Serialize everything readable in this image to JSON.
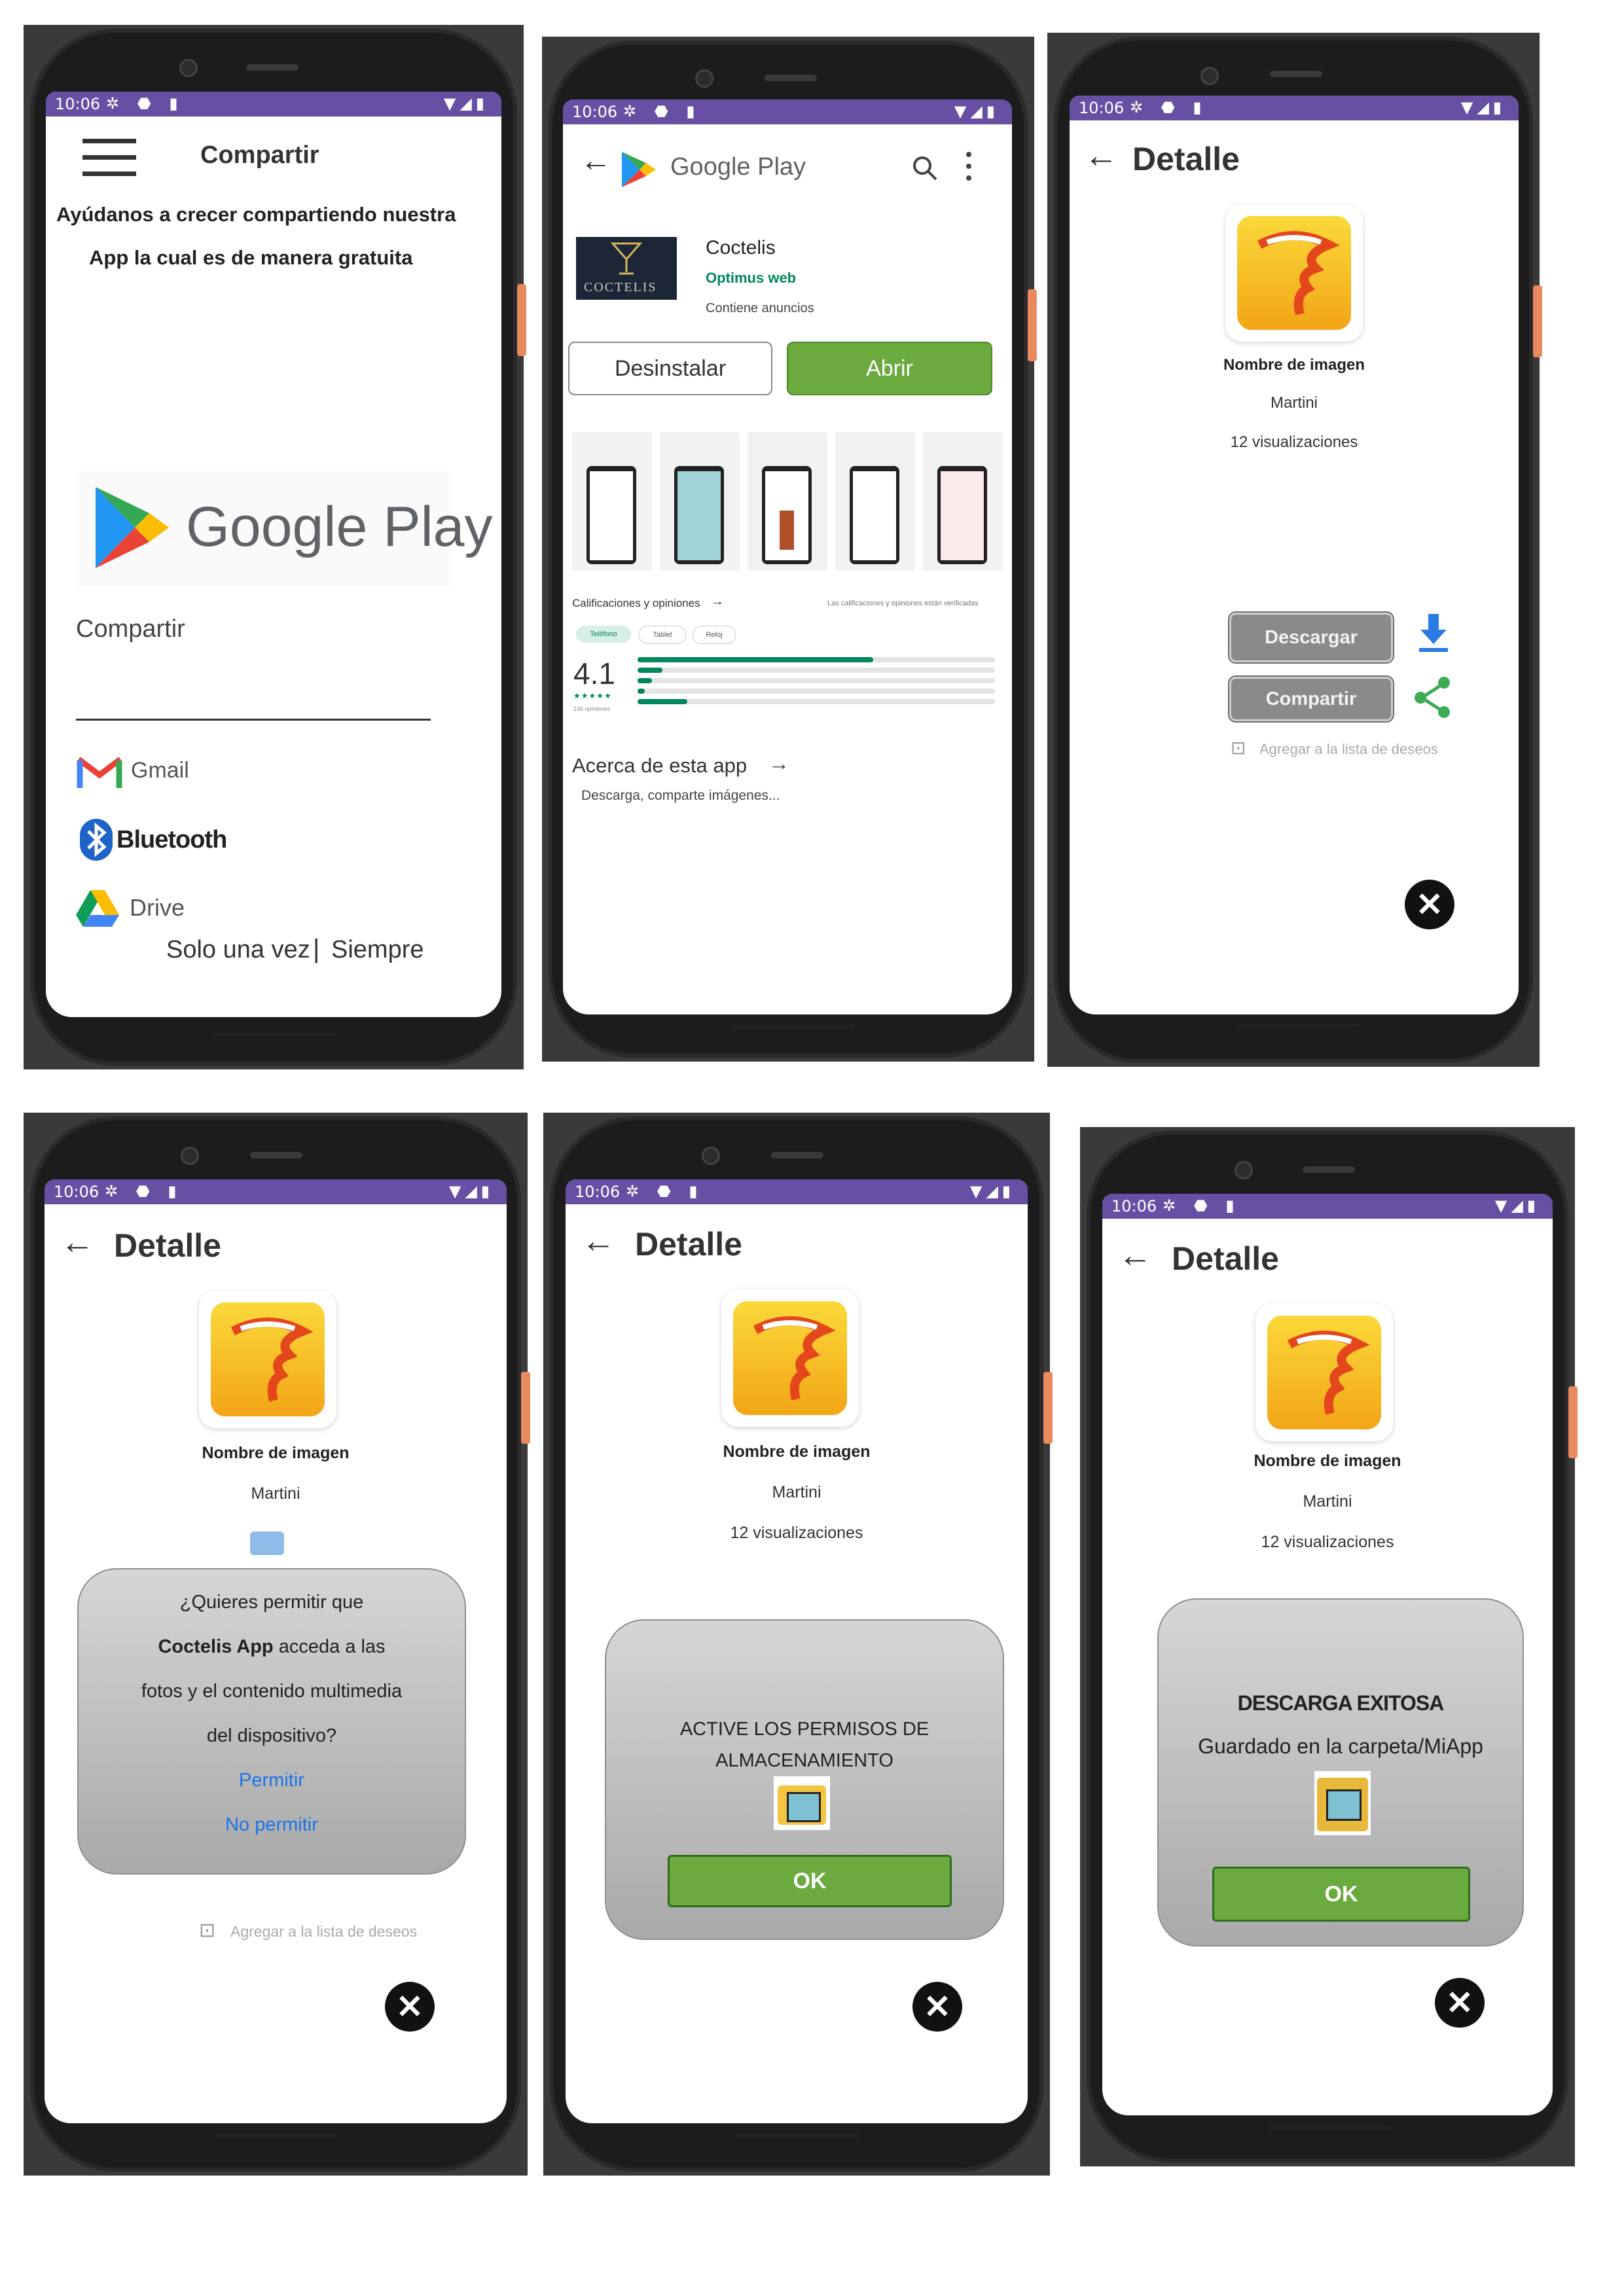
{
  "status": {
    "time": "10:06",
    "left_icons": "✲ ⬣ ▮",
    "right_icons": "▼◢▮"
  },
  "screen1": {
    "title": "Compartir",
    "message_line1": "Ayúdanos a crecer compartiendo nuestra",
    "message_line2": "App la cual es de manera gratuita",
    "gp_logo_text": "Google Play",
    "share_label": "Compartir",
    "options": [
      {
        "label": "Gmail",
        "icon": "gmail-icon"
      },
      {
        "label": "Bluetooth",
        "icon": "bluetooth-icon"
      },
      {
        "label": "Drive",
        "icon": "drive-icon"
      }
    ],
    "once": "Solo una vez",
    "separator": "|",
    "always": "Siempre"
  },
  "screen2": {
    "store_name": "Google Play",
    "app_name": "Coctelis",
    "developer": "Optimus web",
    "ads": "Contiene anuncios",
    "logo_text": "COCTELIS",
    "uninstall": "Desinstalar",
    "open": "Abrir",
    "ratings_title": "Calificaciones y opiniones",
    "ratings_note": "Las calificaciones y opiniones están verificadas",
    "chips": [
      "Teléfono",
      "Tablet",
      "Reloj"
    ],
    "rating": "4.1",
    "stars": "★★★★★",
    "reviews_count": "136 opiniones",
    "rating_bars": [
      0.66,
      0.07,
      0.04,
      0.02,
      0.14
    ],
    "about_title": "Acerca de esta app",
    "about_text": "Descarga, comparte imágenes..."
  },
  "detail": {
    "title": "Detalle",
    "image_name_label": "Nombre de imagen",
    "image_name": "Martini",
    "views": "12 visualizaciones",
    "download": "Descargar",
    "share": "Compartir",
    "wishlist": "Agregar a la lista de deseos",
    "close": "✕"
  },
  "permission_dialog": {
    "line1": "¿Quieres permitir que",
    "app": "Coctelis App",
    "line2_rest": "acceda a las",
    "line3": "fotos y el contenido multimedia",
    "line4": "del dispositivo?",
    "allow": "Permitir",
    "deny": "No permitir"
  },
  "storage_dialog": {
    "line1": "ACTIVE LOS PERMISOS DE",
    "line2": "ALMACENAMIENTO",
    "ok": "OK"
  },
  "success_dialog": {
    "title": "DESCARGA EXITOSA",
    "message": "Guardado en la carpeta/MiApp",
    "ok": "OK"
  },
  "colors": {
    "status_bar": "#6750a4",
    "ok_green": "#6aaa3e",
    "link_blue": "#1a73e8",
    "play_green": "#01875f"
  }
}
